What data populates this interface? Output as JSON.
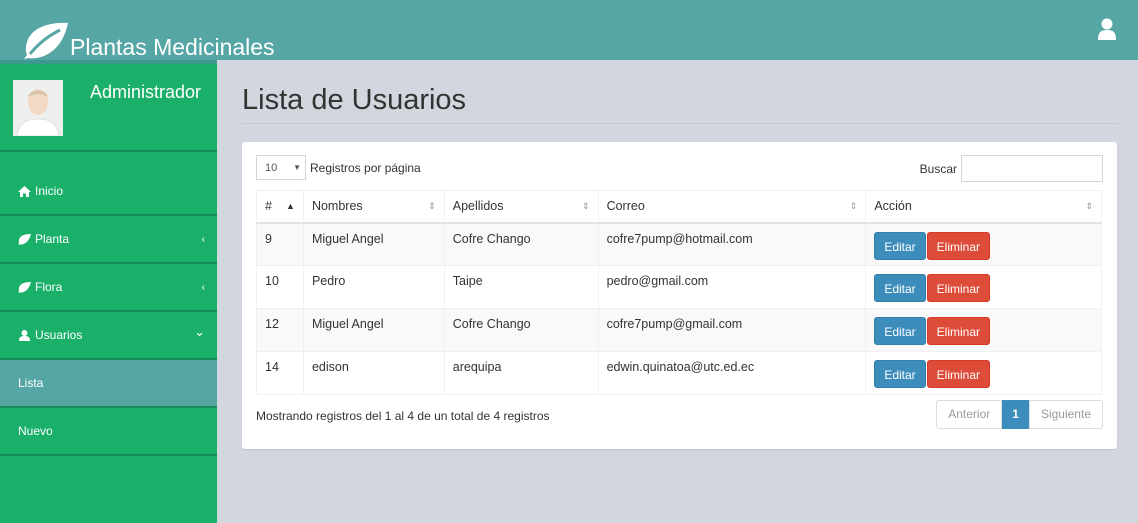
{
  "header": {
    "brand": "Plantas Medicinales",
    "brand_icon": "leaf-icon",
    "user_icon": "user-icon",
    "color": "#56a6a6"
  },
  "sidebar": {
    "user_name": "Administrador",
    "color": "#1bb06a",
    "items": [
      {
        "label": "Inicio",
        "icon": "home-icon"
      },
      {
        "label": "Planta",
        "icon": "leaf-icon",
        "chevron": "‹"
      },
      {
        "label": "Flora",
        "icon": "leaf-icon",
        "chevron": "‹"
      },
      {
        "label": "Usuarios",
        "icon": "user-icon",
        "chevron": "⌄"
      },
      {
        "label": "Lista"
      },
      {
        "label": "Nuevo"
      }
    ]
  },
  "main": {
    "title": "Lista de Usuarios",
    "length": {
      "value": "10",
      "label": "Registros por página"
    },
    "search": {
      "label": "Buscar",
      "value": ""
    },
    "columns": [
      "#",
      "Nombres",
      "Apellidos",
      "Correo",
      "Acción"
    ],
    "rows": [
      {
        "id": "9",
        "nombres": "Miguel Angel",
        "apellidos": "Cofre Chango",
        "correo": "cofre7pump@hotmail.com"
      },
      {
        "id": "10",
        "nombres": "Pedro",
        "apellidos": "Taipe",
        "correo": "pedro@gmail.com"
      },
      {
        "id": "12",
        "nombres": "Miguel Angel",
        "apellidos": "Cofre Chango",
        "correo": "cofre7pump@gmail.com"
      },
      {
        "id": "14",
        "nombres": "edison",
        "apellidos": "arequipa",
        "correo": "edwin.quinatoa@utc.ed.ec"
      }
    ],
    "actions": {
      "edit": "Editar",
      "delete": "Eliminar"
    },
    "info": "Mostrando registros del 1 al 4 de un total de 4 registros",
    "pager": {
      "prev": "Anterior",
      "current": "1",
      "next": "Siguiente"
    }
  }
}
